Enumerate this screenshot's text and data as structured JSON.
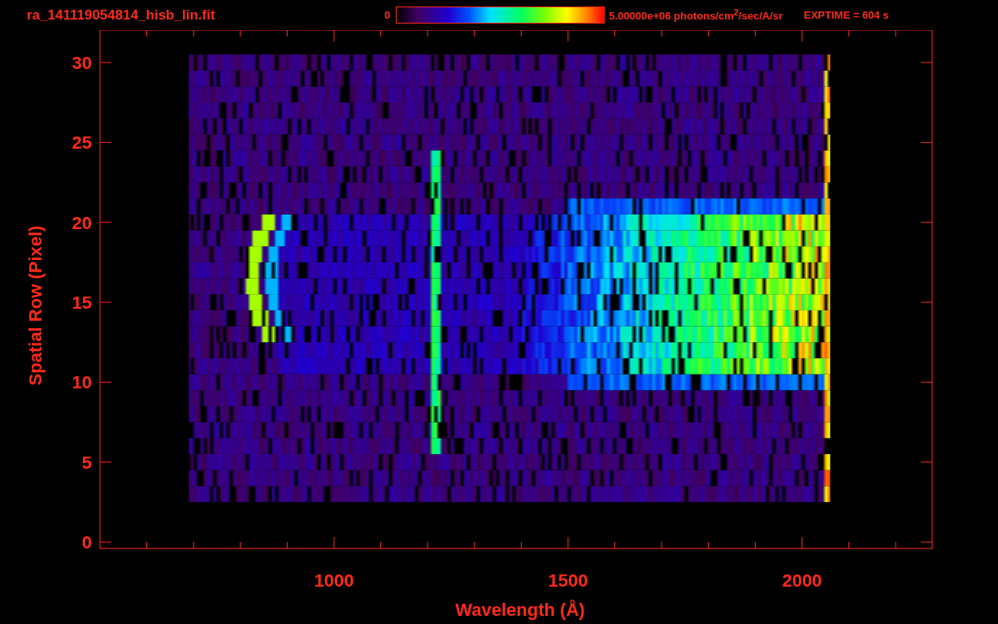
{
  "header": {
    "title": "ra_141119054814_hisb_lin.fit",
    "colorbar_min": "0",
    "colorbar_max": "5.00000e+06 photons/cm$^{2}$/sec/A/sr",
    "exposure": "EXPTIME = 604 s"
  },
  "plot": {
    "x_axis_title": "Wavelength (Å)",
    "y_axis_title": "Spatial Row (Pixel)",
    "x_tick_labels": [
      "1000",
      "1500",
      "2000"
    ],
    "y_tick_labels": [
      "30",
      "25",
      "20",
      "15",
      "10",
      "5",
      "0"
    ]
  }
}
